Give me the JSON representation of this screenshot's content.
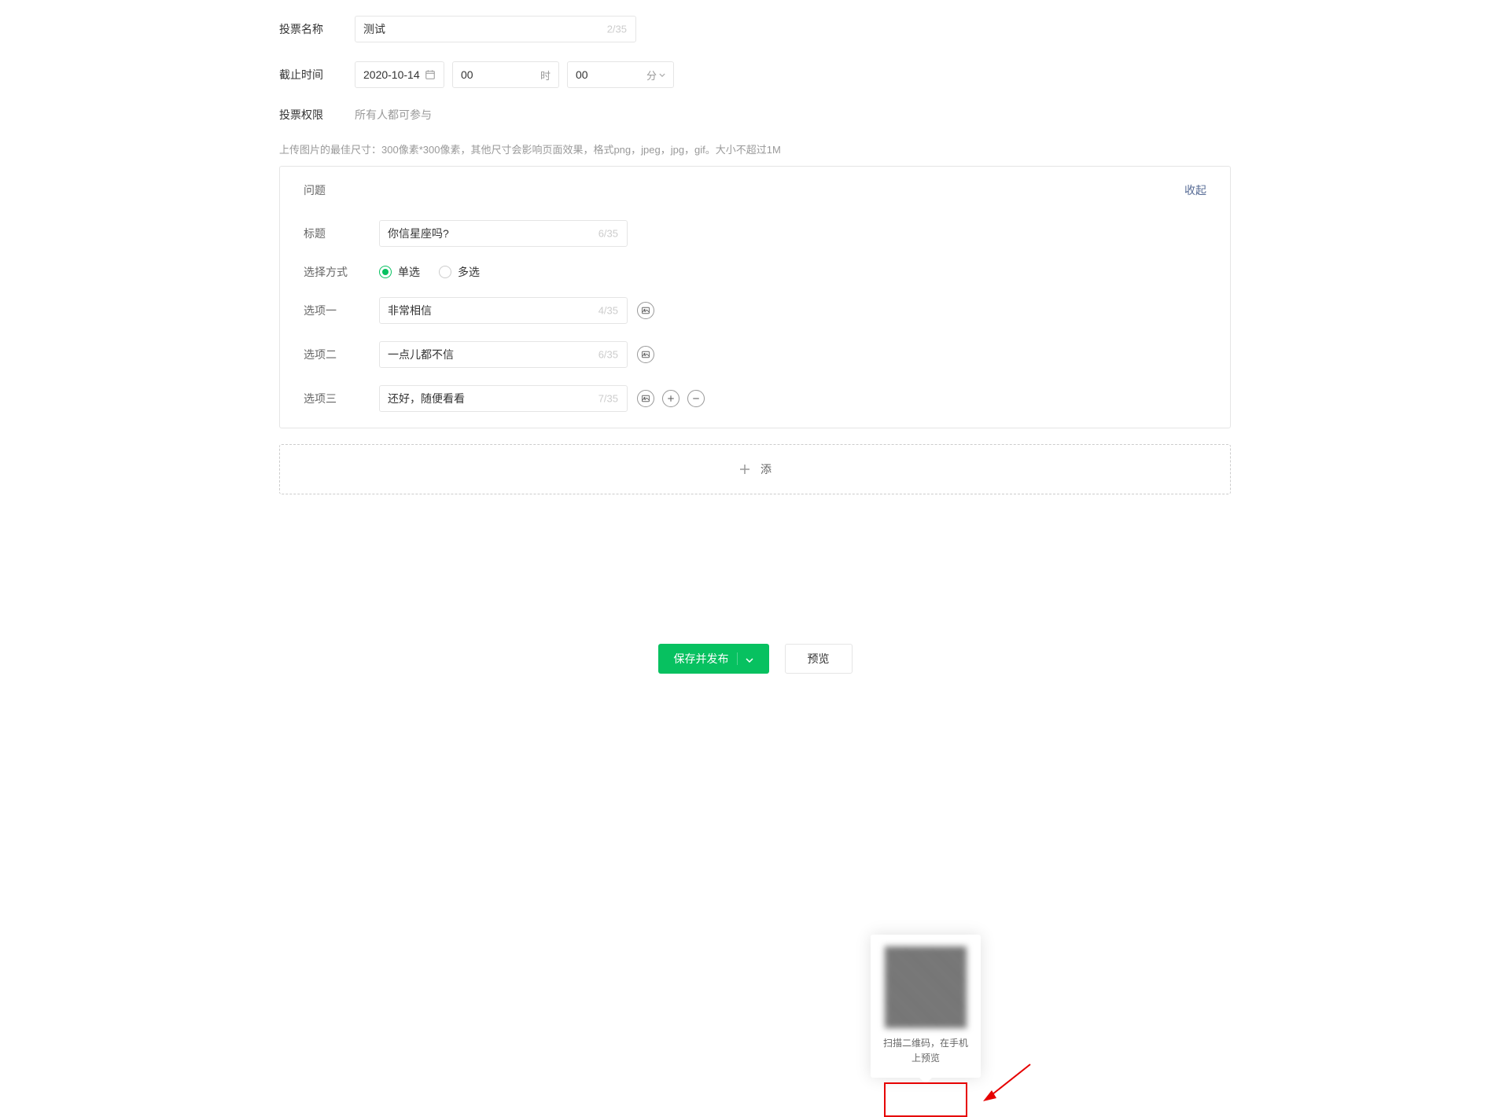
{
  "form": {
    "name_label": "投票名称",
    "name_value": "测试",
    "name_counter": "2/35",
    "deadline_label": "截止时间",
    "deadline_date": "2020-10-14",
    "deadline_hour": "00",
    "deadline_hour_suffix": "时",
    "deadline_minute": "00",
    "deadline_minute_suffix": "分",
    "permission_label": "投票权限",
    "permission_text": "所有人都可参与"
  },
  "hint": "上传图片的最佳尺寸：300像素*300像素，其他尺寸会影响页面效果，格式png，jpeg，jpg，gif。大小不超过1M",
  "question": {
    "panel_title": "问题",
    "collapse": "收起",
    "title_label": "标题",
    "title_value": "你信星座吗?",
    "title_counter": "6/35",
    "select_mode_label": "选择方式",
    "radio_single": "单选",
    "radio_multi": "多选",
    "options": [
      {
        "label": "选项一",
        "value": "非常相信",
        "counter": "4/35"
      },
      {
        "label": "选项二",
        "value": "一点儿都不信",
        "counter": "6/35"
      },
      {
        "label": "选项三",
        "value": "还好，随便看看",
        "counter": "7/35"
      }
    ]
  },
  "add_question": "添",
  "qr_popup": {
    "text": "扫描二维码，在手机上预览"
  },
  "buttons": {
    "save_publish": "保存并发布",
    "preview": "预览"
  }
}
